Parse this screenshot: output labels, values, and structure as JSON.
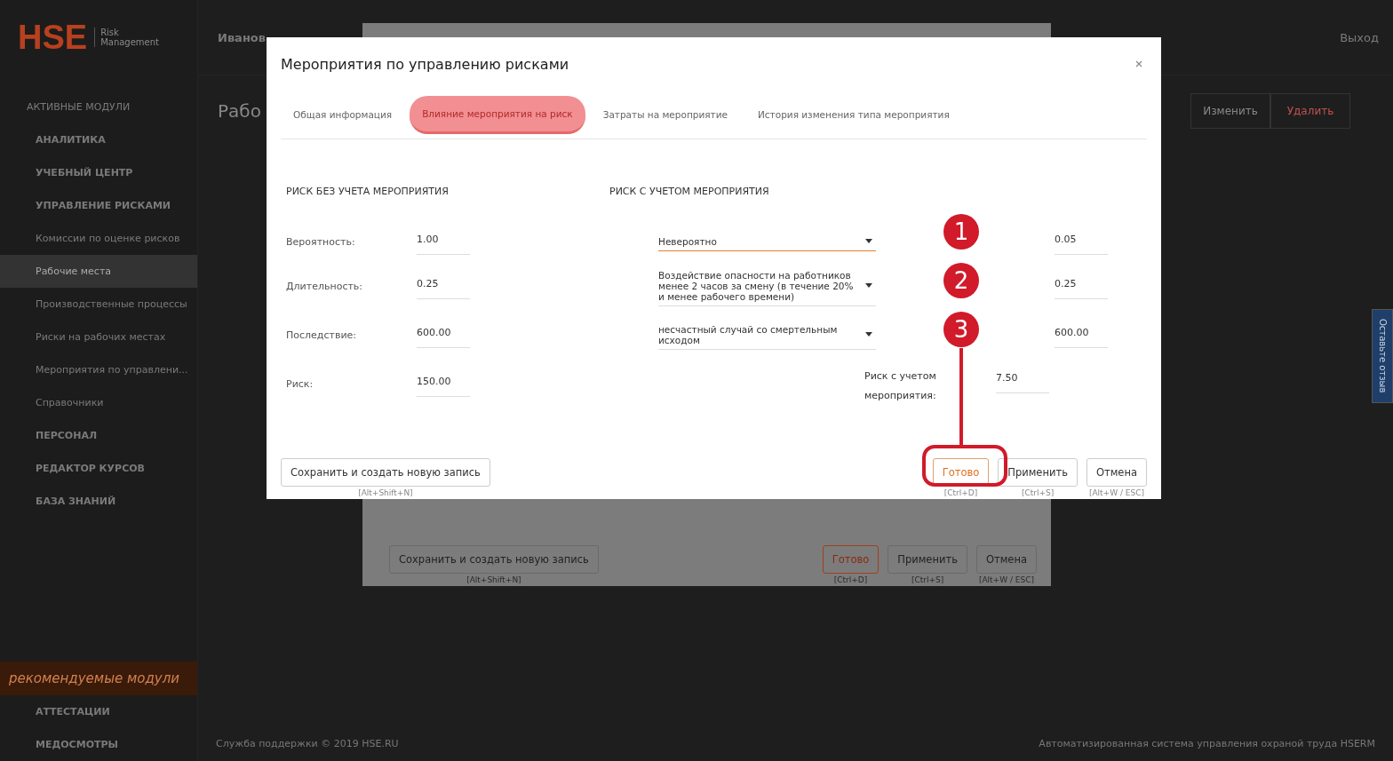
{
  "app": {
    "logo": "HSE",
    "logo_subtitle": "Risk Management",
    "user": "Иванов",
    "logout": "Выход",
    "page_title": "Рабо",
    "feedback": "Оставьте отзыв",
    "sidebar": {
      "heading": "АКТИВНЫЕ МОДУЛИ",
      "items": [
        {
          "label": "АНАЛИТИКА",
          "kind": "group",
          "selected": false
        },
        {
          "label": "УЧЕБНЫЙ ЦЕНТР",
          "kind": "group",
          "selected": false
        },
        {
          "label": "УПРАВЛЕНИЕ РИСКАМИ",
          "kind": "group",
          "selected": false
        },
        {
          "label": "Комиссии по оценке рисков",
          "kind": "sub",
          "selected": false
        },
        {
          "label": "Рабочие места",
          "kind": "sub",
          "selected": true
        },
        {
          "label": "Производственные процессы",
          "kind": "sub",
          "selected": false
        },
        {
          "label": "Риски на рабочих местах",
          "kind": "sub",
          "selected": false
        },
        {
          "label": "Мероприятия по управлени...",
          "kind": "sub",
          "selected": false
        },
        {
          "label": "Справочники",
          "kind": "sub",
          "selected": false
        },
        {
          "label": "ПЕРСОНАЛ",
          "kind": "group",
          "selected": false
        },
        {
          "label": "РЕДАКТОР КУРСОВ",
          "kind": "group",
          "selected": false
        },
        {
          "label": "БАЗА ЗНАНИЙ",
          "kind": "group",
          "selected": false
        }
      ],
      "recommended": "рекомендуемые модули",
      "extra": [
        "АТТЕСТАЦИИ",
        "МЕДОСМОТРЫ"
      ]
    },
    "page_buttons": [
      "Изменить",
      "Удалить"
    ],
    "footer_left": "Служба поддержки © 2019 HSE.RU",
    "footer_right": "Автоматизированная система управления охраной труда HSERM"
  },
  "back_dialog": {
    "save_new": {
      "label": "Сохранить и создать новую запись",
      "hint": "[Alt+Shift+N]"
    },
    "buttons": [
      {
        "label": "Готово",
        "hint": "[Ctrl+D]",
        "primary": true
      },
      {
        "label": "Применить",
        "hint": "[Ctrl+S]",
        "primary": false
      },
      {
        "label": "Отмена",
        "hint": "[Alt+W / ESC]",
        "primary": false
      }
    ]
  },
  "dialog": {
    "title": "Мероприятия по управлению рисками",
    "tabs": [
      {
        "label": "Общая информация",
        "selected": false
      },
      {
        "label": "Влияние мероприятия на риск",
        "selected": true
      },
      {
        "label": "Затраты на мероприятие",
        "selected": false
      },
      {
        "label": "История изменения типа мероприятия",
        "selected": false
      }
    ],
    "without": {
      "heading": "РИСК БЕЗ УЧЕТА МЕРОПРИЯТИЯ",
      "rows": [
        {
          "label": "Вероятность:",
          "value": "1.00"
        },
        {
          "label": "Длительность:",
          "value": "0.25"
        },
        {
          "label": "Последствие:",
          "value": "600.00"
        },
        {
          "label": "Риск:",
          "value": "150.00"
        }
      ]
    },
    "with": {
      "heading": "РИСК С УЧЕТОМ МЕРОПРИЯТИЯ",
      "rows": [
        {
          "choice": "Невероятно",
          "value": "0.05",
          "focused": true
        },
        {
          "choice": "Воздействие опасности на работников менее 2 часов за смену (в течение 20% и менее рабочего времени)",
          "value": "0.25",
          "focused": false
        },
        {
          "choice": "несчастный случай со смертельным исходом",
          "value": "600.00",
          "focused": false
        }
      ],
      "total_label": "Риск с учетом мероприятия:",
      "total_value": "7.50"
    },
    "save_new": {
      "label": "Сохранить и создать новую запись",
      "hint": "[Alt+Shift+N]"
    },
    "buttons": [
      {
        "label": "Готово",
        "hint": "[Ctrl+D]",
        "primary": true
      },
      {
        "label": "Применить",
        "hint": "[Ctrl+S]",
        "primary": false
      },
      {
        "label": "Отмена",
        "hint": "[Alt+W / ESC]",
        "primary": false
      }
    ]
  },
  "annotations": [
    "1",
    "2",
    "3"
  ]
}
